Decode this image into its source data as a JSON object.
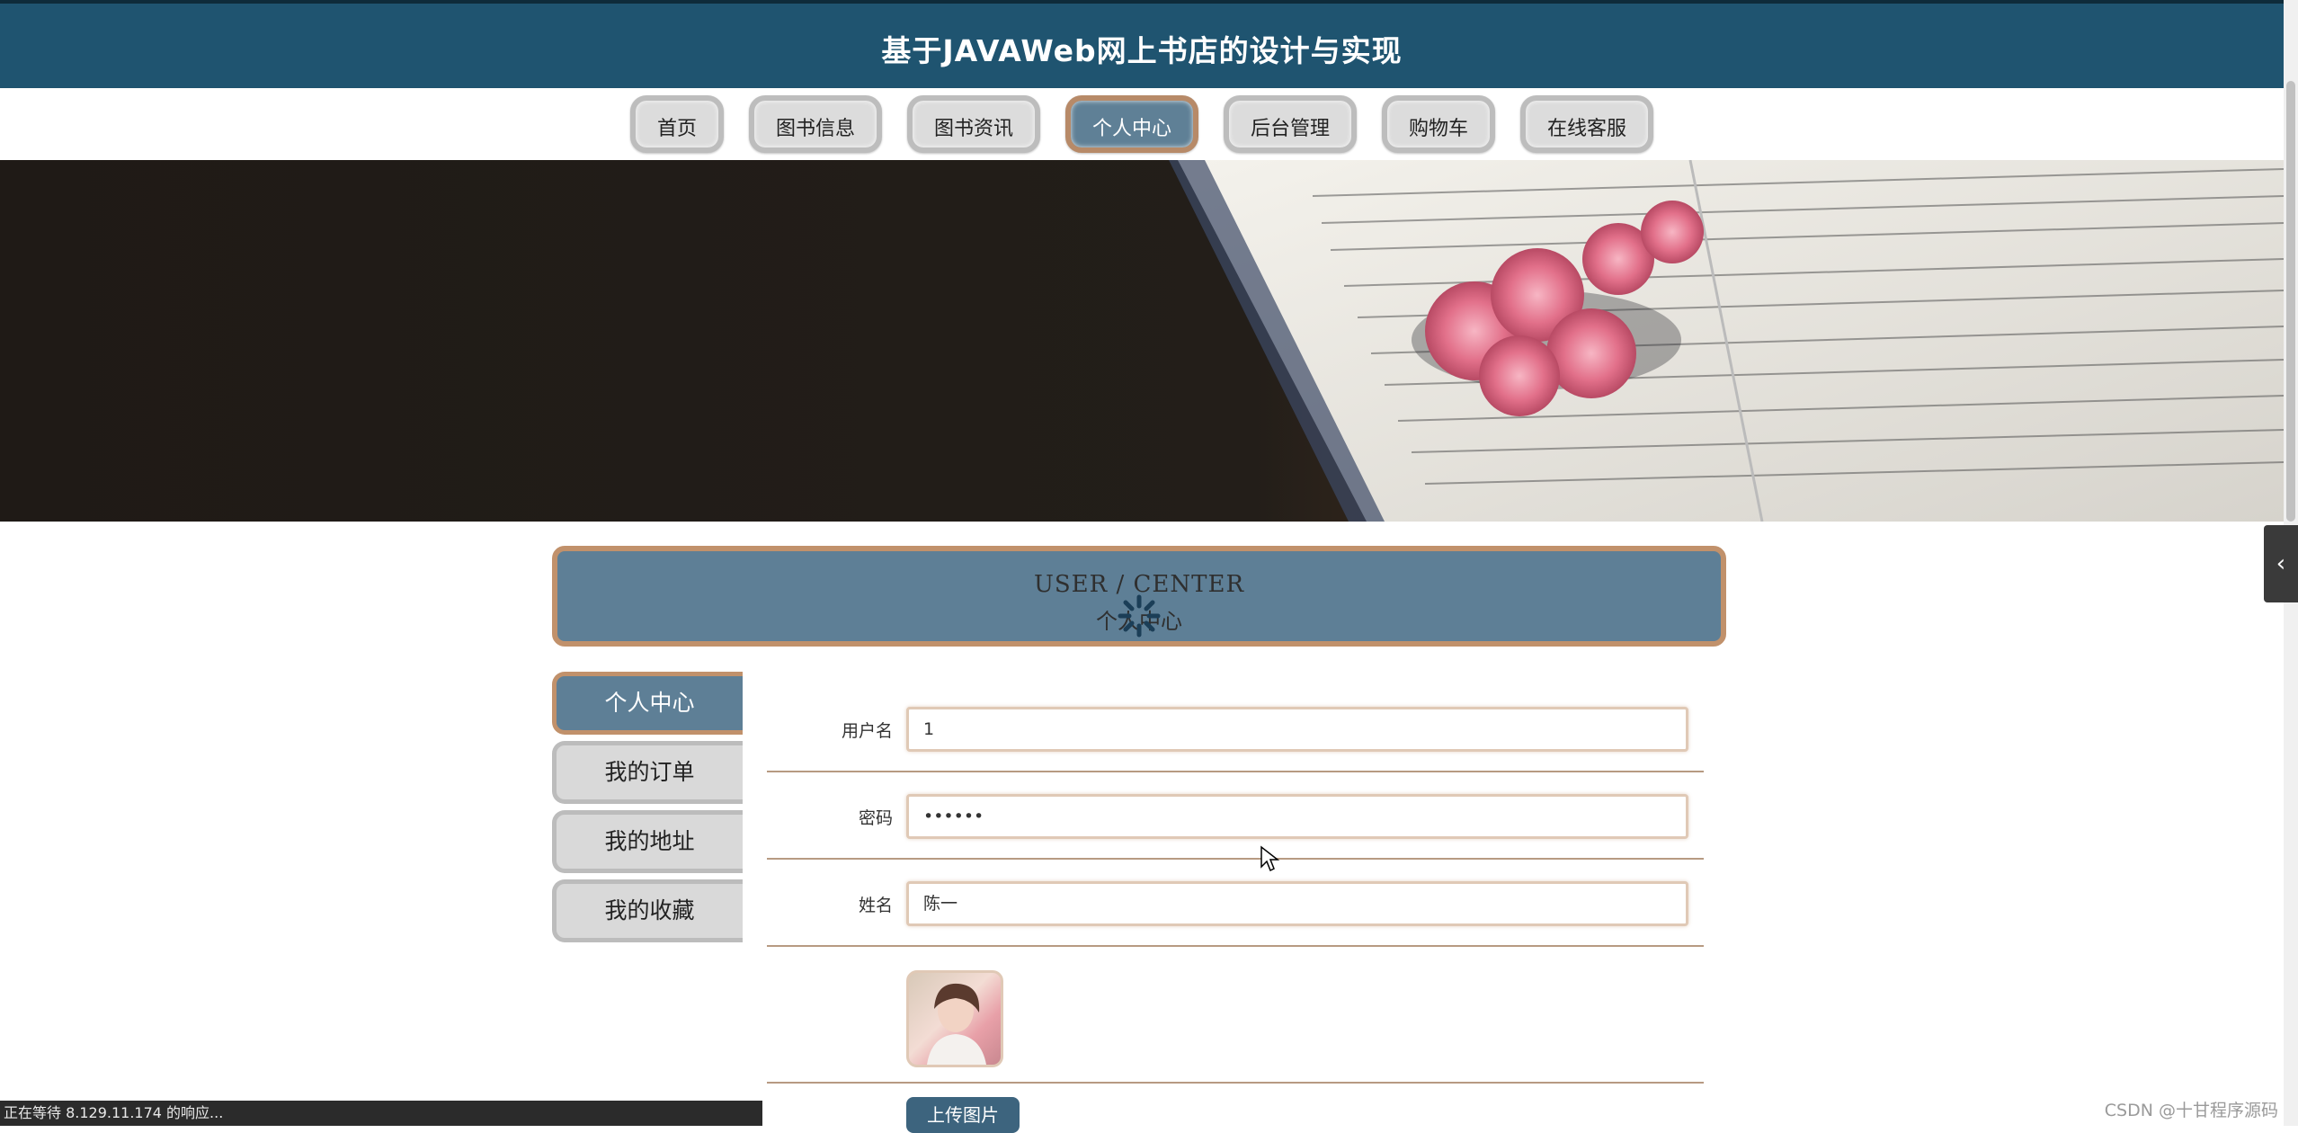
{
  "header": {
    "title": "基于JAVAWeb网上书店的设计与实现"
  },
  "nav": {
    "items": [
      {
        "label": "首页",
        "active": false
      },
      {
        "label": "图书信息",
        "active": false
      },
      {
        "label": "图书资讯",
        "active": false
      },
      {
        "label": "个人中心",
        "active": true
      },
      {
        "label": "后台管理",
        "active": false
      },
      {
        "label": "购物车",
        "active": false
      },
      {
        "label": "在线客服",
        "active": false
      }
    ]
  },
  "center_header": {
    "title_en": "USER / CENTER",
    "title_cn": "个人中心"
  },
  "sidebar": {
    "items": [
      {
        "label": "个人中心",
        "active": true
      },
      {
        "label": "我的订单",
        "active": false
      },
      {
        "label": "我的地址",
        "active": false
      },
      {
        "label": "我的收藏",
        "active": false
      }
    ]
  },
  "form": {
    "username_label": "用户名",
    "username_value": "1",
    "password_label": "密码",
    "password_value": "••••••",
    "name_label": "姓名",
    "name_value": "陈一",
    "upload_label": "上传图片"
  },
  "status": {
    "text": "正在等待 8.129.11.174 的响应...",
    "watermark": "CSDN @十甘程序源码"
  },
  "colors": {
    "header_bg": "#1f5470",
    "accent": "#5e7f96",
    "border_accent": "#c1916b"
  }
}
